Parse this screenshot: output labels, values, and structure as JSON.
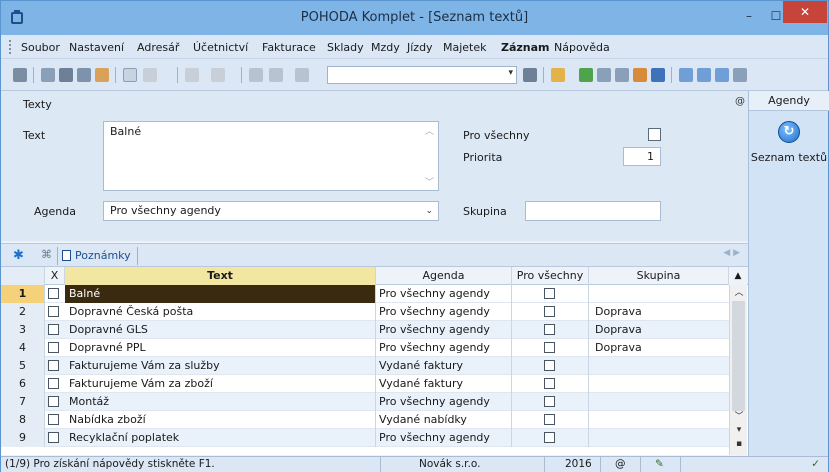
{
  "window": {
    "title": "POHODA Komplet - [Seznam textů]",
    "buttons": {
      "minimize": "–",
      "maximize": "☐",
      "close": "✕"
    }
  },
  "menu": [
    "Soubor",
    "Nastavení",
    "Adresář",
    "Účetnictví",
    "Fakturace",
    "Sklady",
    "Mzdy",
    "Jízdy",
    "Majetek",
    "Záznam",
    "Nápověda"
  ],
  "form": {
    "section_title": "Texty",
    "text_label": "Text",
    "text_value": "Balné",
    "pro_vsechny_label": "Pro všechny",
    "priorita_label": "Priorita",
    "priorita_value": "1",
    "agenda_label": "Agenda",
    "agenda_value": "Pro všechny agendy",
    "skupina_label": "Skupina",
    "skupina_value": ""
  },
  "tabs": {
    "notes": "Poznámky"
  },
  "right_panel": {
    "header": "Agendy",
    "item_label": "Seznam textů"
  },
  "table": {
    "headers": {
      "x": "X",
      "text": "Text",
      "agenda": "Agenda",
      "pro_vsechny": "Pro všechny",
      "skupina": "Skupina"
    },
    "rows": [
      {
        "num": "1",
        "text": "Balné",
        "agenda": "Pro všechny agendy",
        "skupina": ""
      },
      {
        "num": "2",
        "text": "Dopravné Česká pošta",
        "agenda": "Pro všechny agendy",
        "skupina": "Doprava"
      },
      {
        "num": "3",
        "text": "Dopravné GLS",
        "agenda": "Pro všechny agendy",
        "skupina": "Doprava"
      },
      {
        "num": "4",
        "text": "Dopravné PPL",
        "agenda": "Pro všechny agendy",
        "skupina": "Doprava"
      },
      {
        "num": "5",
        "text": "Fakturujeme Vám za služby",
        "agenda": "Vydané faktury",
        "skupina": ""
      },
      {
        "num": "6",
        "text": "Fakturujeme Vám za zboží",
        "agenda": "Vydané faktury",
        "skupina": ""
      },
      {
        "num": "7",
        "text": "Montáž",
        "agenda": "Pro všechny agendy",
        "skupina": ""
      },
      {
        "num": "8",
        "text": "Nabídka zboží",
        "agenda": "Vydané nabídky",
        "skupina": ""
      },
      {
        "num": "9",
        "text": "Recyklační poplatek",
        "agenda": "Pro všechny agendy",
        "skupina": ""
      }
    ]
  },
  "status": {
    "help": "(1/9) Pro získání nápovědy stiskněte F1.",
    "company": "Novák s.r.o.",
    "year": "2016",
    "at": "@"
  },
  "colors": {
    "titlebar": "#7fb4e6",
    "close": "#c7443b",
    "selected_row": "#3a2a10",
    "sort_header": "#f2e6a0"
  }
}
